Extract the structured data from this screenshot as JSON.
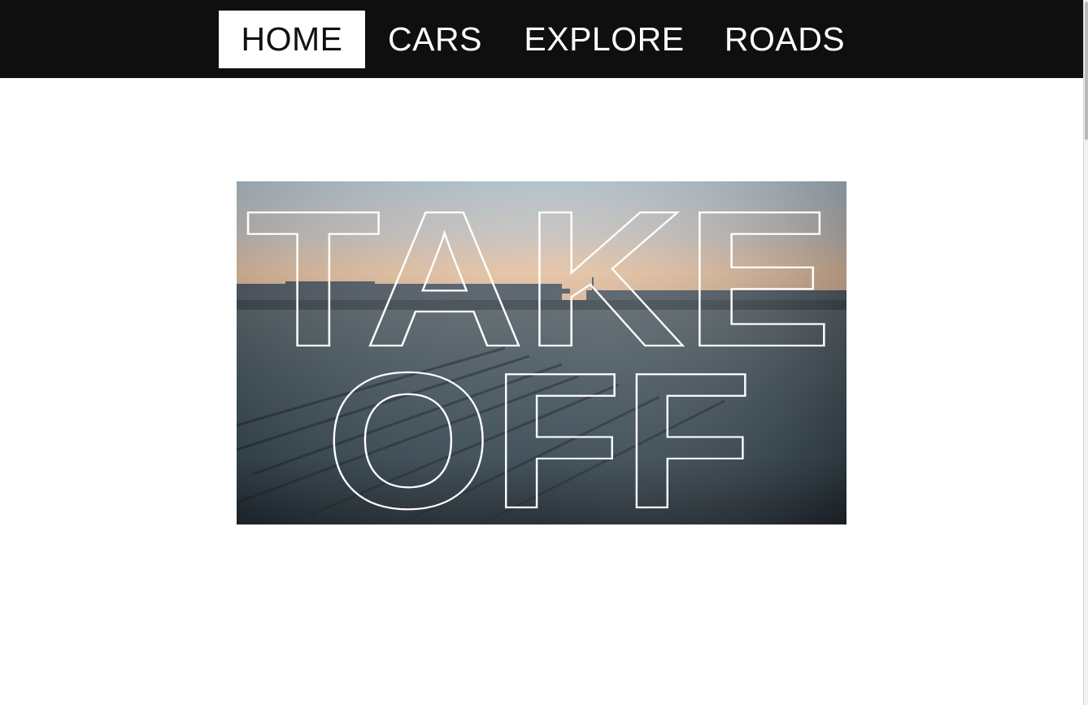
{
  "nav": {
    "items": [
      {
        "label": "HOME",
        "active": true
      },
      {
        "label": "CARS",
        "active": false
      },
      {
        "label": "EXPLORE",
        "active": false
      },
      {
        "label": "ROADS",
        "active": false
      }
    ]
  },
  "hero": {
    "line1": "TAKE",
    "line2": "OFF"
  },
  "colors": {
    "nav_background": "#0f0f0f",
    "nav_text": "#ffffff",
    "active_background": "#ffffff",
    "active_text": "#111111",
    "outline_text": "#ffffff"
  }
}
